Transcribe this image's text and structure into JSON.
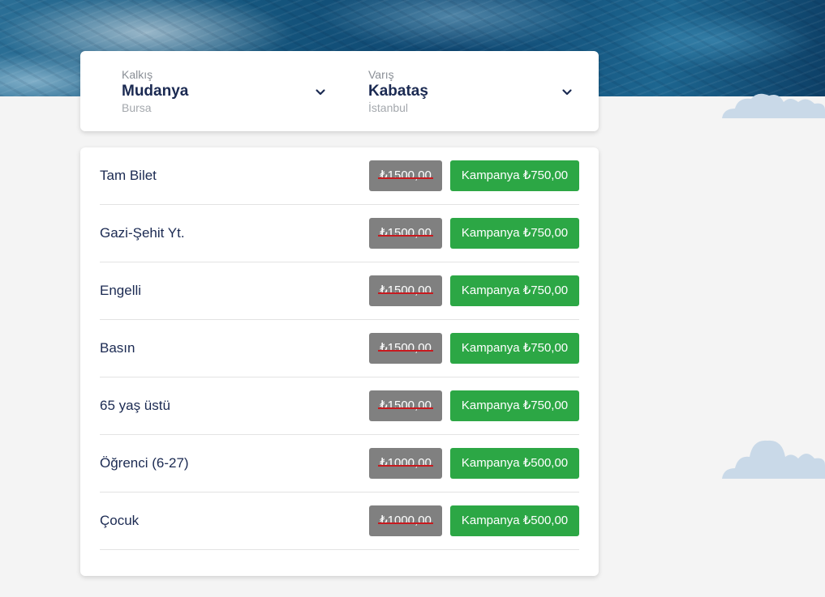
{
  "route": {
    "departure": {
      "label": "Kalkış",
      "city": "Mudanya",
      "region": "Bursa"
    },
    "arrival": {
      "label": "Varış",
      "city": "Kabataş",
      "region": "İstanbul"
    }
  },
  "fares": [
    {
      "name": "Tam Bilet",
      "old_price": "₺1500,00",
      "campaign": "Kampanya ₺750,00"
    },
    {
      "name": "Gazi-Şehit Yt.",
      "old_price": "₺1500,00",
      "campaign": "Kampanya ₺750,00"
    },
    {
      "name": "Engelli",
      "old_price": "₺1500,00",
      "campaign": "Kampanya ₺750,00"
    },
    {
      "name": "Basın",
      "old_price": "₺1500,00",
      "campaign": "Kampanya ₺750,00"
    },
    {
      "name": "65 yaş üstü",
      "old_price": "₺1500,00",
      "campaign": "Kampanya ₺750,00"
    },
    {
      "name": "Öğrenci (6-27)",
      "old_price": "₺1000,00",
      "campaign": "Kampanya ₺500,00"
    },
    {
      "name": "Çocuk",
      "old_price": "₺1000,00",
      "campaign": "Kampanya ₺500,00"
    }
  ],
  "colors": {
    "campaign_green": "#2ca745",
    "old_price_gray": "#808080",
    "strike_red": "#c8191e",
    "text_navy": "#1b2a52"
  },
  "icons": [
    "chevron-down-icon",
    "cloud-icon"
  ]
}
